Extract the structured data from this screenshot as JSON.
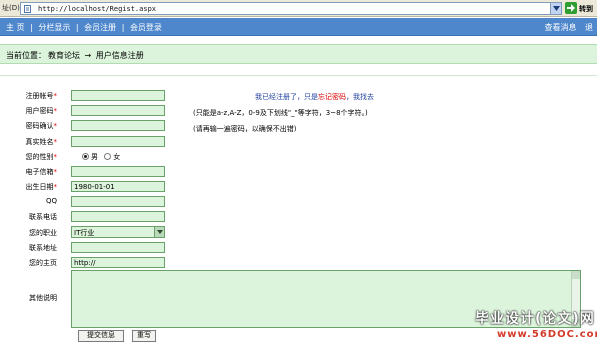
{
  "browser": {
    "address_label": "址(D)",
    "url": "http://localhost/Regist.aspx",
    "go_label": "转到"
  },
  "nav": {
    "items": [
      "主 页",
      "分栏显示",
      "会员注册",
      "会员登录"
    ],
    "right": [
      "查看消息",
      "退"
    ]
  },
  "breadcrumb": {
    "prefix": "当前位置：",
    "forum": "教育论坛",
    "arrow": "→",
    "page": "用户信息注册"
  },
  "form": {
    "fields": [
      {
        "label": "注册帐号",
        "required": true,
        "value": ""
      },
      {
        "label": "用户密码",
        "required": true,
        "value": ""
      },
      {
        "label": "密码确认",
        "required": true,
        "value": ""
      },
      {
        "label": "真实姓名",
        "required": true,
        "value": ""
      },
      {
        "label": "您的性别",
        "required": true
      },
      {
        "label": "电子信箱",
        "required": true,
        "value": ""
      },
      {
        "label": "出生日期",
        "required": true,
        "value": "1980-01-01"
      },
      {
        "label": "QQ",
        "required": false,
        "value": ""
      },
      {
        "label": "联系电话",
        "required": false,
        "value": ""
      },
      {
        "label": "您的职业",
        "required": false,
        "value": "IT行业"
      },
      {
        "label": "联系地址",
        "required": false,
        "value": ""
      },
      {
        "label": "您的主页",
        "required": false,
        "value": "http://"
      }
    ],
    "gender": {
      "male": "男",
      "female": "女",
      "selected": "男"
    },
    "notes_label": "其他说明",
    "submit_label": "提交信息",
    "reset_label": "重写"
  },
  "hints": {
    "registered": "我已经注册了，只是",
    "forgot": "忘记密码",
    "find": "，我找去",
    "username_rule": "(只能是a-z,A-Z，0-9及下划线\"_\"等字符，3~8个字符。)",
    "password_rule": "(请再输一遍密码，以确保不出错)"
  },
  "watermark": {
    "line1": "毕业设计(论文)网",
    "line2": "www.56DOC.com"
  },
  "colors": {
    "nav": "#4f87cc",
    "field_bg": "#dcf4dc",
    "required": "#e00000",
    "link": "#1f3fa0"
  }
}
